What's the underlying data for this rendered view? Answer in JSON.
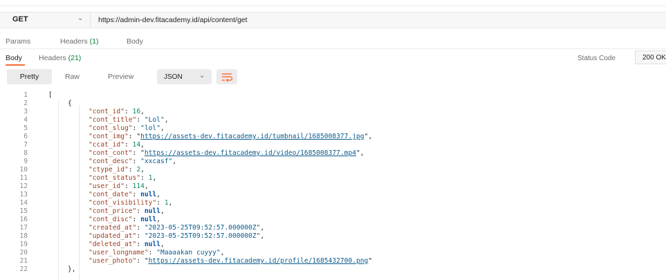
{
  "request": {
    "method": "GET",
    "url": "https://admin-dev.fitacademy.id/api/content/get",
    "tabs": [
      {
        "label": "Params",
        "count": ""
      },
      {
        "label": "Headers",
        "count": "(1)"
      },
      {
        "label": "Body",
        "count": ""
      }
    ]
  },
  "response": {
    "tabs": [
      {
        "label": "Body",
        "count": ""
      },
      {
        "label": "Headers",
        "count": "(21)"
      }
    ],
    "status_label": "Status Code",
    "status_value": "200 OK",
    "view_tabs": [
      "Pretty",
      "Raw",
      "Preview"
    ],
    "format": "JSON",
    "icons": {
      "method_dropdown": "chevron-down-icon",
      "format_dropdown": "chevron-down-icon",
      "wrap": "wrap-lines-icon"
    },
    "colors": {
      "accent": "#ff6c37",
      "count": "#007f31"
    }
  },
  "code_lines": [
    {
      "num": "1",
      "indent": 0,
      "text": "["
    },
    {
      "num": "2",
      "indent": 1,
      "text": "{"
    },
    {
      "num": "3",
      "indent": 2,
      "key": "\"cont_id\"",
      "val": "16",
      "type": "n",
      "comma": true
    },
    {
      "num": "4",
      "indent": 2,
      "key": "\"cont_title\"",
      "val": "\"Lol\"",
      "type": "s",
      "comma": true
    },
    {
      "num": "5",
      "indent": 2,
      "key": "\"cont_slug\"",
      "val": "\"lol\"",
      "type": "s",
      "comma": true
    },
    {
      "num": "6",
      "indent": 2,
      "key": "\"cont_img\"",
      "val": "https://assets-dev.fitacademy.id/tumbnail/1685008377.jpg",
      "type": "u",
      "comma": true
    },
    {
      "num": "7",
      "indent": 2,
      "key": "\"ccat_id\"",
      "val": "14",
      "type": "n",
      "comma": true
    },
    {
      "num": "8",
      "indent": 2,
      "key": "\"cont_cont\"",
      "val": "https://assets-dev.fitacademy.id/video/1685008377.mp4",
      "type": "u",
      "comma": true
    },
    {
      "num": "9",
      "indent": 2,
      "key": "\"cont_desc\"",
      "val": "\"xxcasf\"",
      "type": "s",
      "comma": true
    },
    {
      "num": "10",
      "indent": 2,
      "key": "\"ctype_id\"",
      "val": "2",
      "type": "n",
      "comma": true
    },
    {
      "num": "11",
      "indent": 2,
      "key": "\"cont_status\"",
      "val": "1",
      "type": "n",
      "comma": true
    },
    {
      "num": "12",
      "indent": 2,
      "key": "\"user_id\"",
      "val": "114",
      "type": "n",
      "comma": true
    },
    {
      "num": "13",
      "indent": 2,
      "key": "\"cont_date\"",
      "val": "null",
      "type": "nl",
      "comma": true
    },
    {
      "num": "14",
      "indent": 2,
      "key": "\"cont_visibility\"",
      "val": "1",
      "type": "n",
      "comma": true
    },
    {
      "num": "15",
      "indent": 2,
      "key": "\"cont_price\"",
      "val": "null",
      "type": "nl",
      "comma": true
    },
    {
      "num": "16",
      "indent": 2,
      "key": "\"cont_disc\"",
      "val": "null",
      "type": "nl",
      "comma": true
    },
    {
      "num": "17",
      "indent": 2,
      "key": "\"created_at\"",
      "val": "\"2023-05-25T09:52:57.000000Z\"",
      "type": "s",
      "comma": true
    },
    {
      "num": "18",
      "indent": 2,
      "key": "\"updated_at\"",
      "val": "\"2023-05-25T09:52:57.000000Z\"",
      "type": "s",
      "comma": true
    },
    {
      "num": "19",
      "indent": 2,
      "key": "\"deleted_at\"",
      "val": "null",
      "type": "nl",
      "comma": true
    },
    {
      "num": "20",
      "indent": 2,
      "key": "\"user_longname\"",
      "val": "\"Maaaakan cuyyy\"",
      "type": "s",
      "comma": true
    },
    {
      "num": "21",
      "indent": 2,
      "key": "\"user_photo\"",
      "val": "https://assets-dev.fitacademy.id/profile/1685432700.png",
      "type": "u",
      "comma": false,
      "quoted": true
    },
    {
      "num": "22",
      "indent": 1,
      "text": "},"
    }
  ]
}
